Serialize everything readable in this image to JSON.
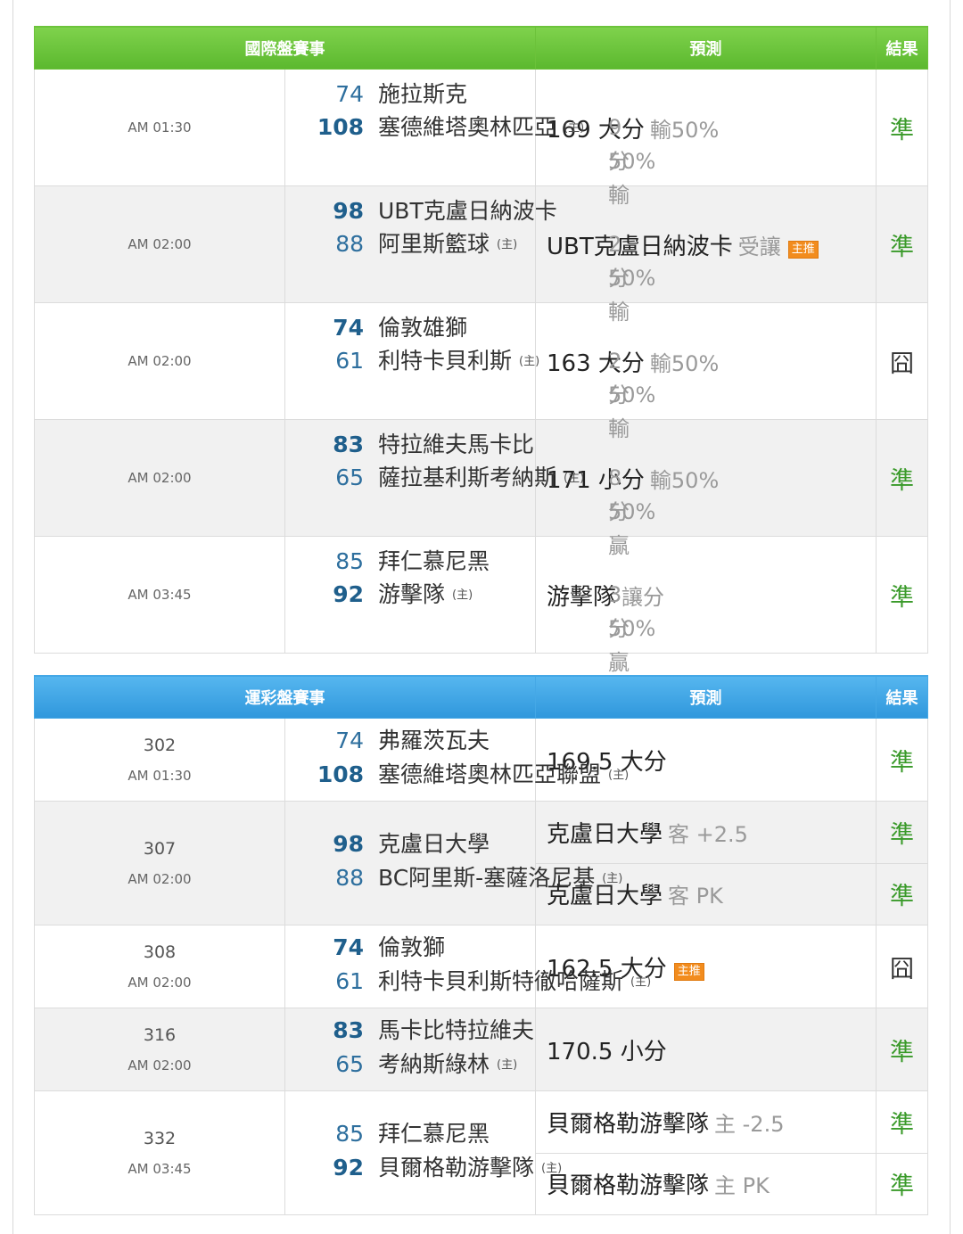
{
  "intl": {
    "header": {
      "event": "國際盤賽事",
      "pred": "預測",
      "result": "結果"
    },
    "rows": [
      {
        "time": "AM 01:30",
        "s1": "74",
        "t1": "施拉斯克",
        "s2": "108",
        "t2": "塞德維塔奧林匹亞",
        "home": "(主)",
        "sp1": "9分輸",
        "sp2": "50%",
        "pred": "169 大分",
        "predsub": "輸50%",
        "badge": "",
        "result": "準",
        "w1": false,
        "w2": true
      },
      {
        "time": "AM 02:00",
        "s1": "98",
        "t1": "UBT克盧日納波卡",
        "s2": "88",
        "t2": "阿里斯籃球",
        "home": "(主)",
        "sp1": "2分輸",
        "sp2": "50%",
        "pred": "UBT克盧日納波卡",
        "predsub": "受讓",
        "badge": "主推",
        "result": "準",
        "w1": true,
        "w2": false
      },
      {
        "time": "AM 02:00",
        "s1": "74",
        "t1": "倫敦雄獅",
        "s2": "61",
        "t2": "利特卡貝利斯",
        "home": "(主)",
        "sp1": "2分輸",
        "sp2": "50%",
        "pred": "163 大分",
        "predsub": "輸50%",
        "badge": "",
        "result": "囧",
        "w1": true,
        "w2": false
      },
      {
        "time": "AM 02:00",
        "s1": "83",
        "t1": "特拉維夫馬卡比",
        "s2": "65",
        "t2": "薩拉基利斯考納斯",
        "home": "(主)",
        "sp1": "8分贏",
        "sp2": "50%",
        "pred": "171 小分",
        "predsub": "輸50%",
        "badge": "",
        "result": "準",
        "w1": true,
        "w2": false
      },
      {
        "time": "AM 03:45",
        "s1": "85",
        "t1": "拜仁慕尼黑",
        "s2": "92",
        "t2": "游擊隊",
        "home": "(主)",
        "sp1": "3分贏",
        "sp2": "50%",
        "pred": "游擊隊",
        "predsub": "讓分",
        "badge": "",
        "result": "準",
        "w1": false,
        "w2": true
      }
    ]
  },
  "lott": {
    "header": {
      "event": "運彩盤賽事",
      "pred": "預測",
      "result": "結果"
    },
    "rows": [
      {
        "code": "302",
        "time": "AM 01:30",
        "s1": "74",
        "t1": "弗羅茨瓦夫",
        "s2": "108",
        "t2": "塞德維塔奧林匹亞聯盟",
        "home": "(主)",
        "w1": false,
        "w2": true,
        "preds": [
          {
            "main": "169.5 大分",
            "sub": "",
            "badge": "",
            "result": "準"
          }
        ]
      },
      {
        "code": "307",
        "time": "AM 02:00",
        "s1": "98",
        "t1": "克盧日大學",
        "s2": "88",
        "t2": "BC阿里斯-塞薩洛尼基",
        "home": "(主)",
        "w1": true,
        "w2": false,
        "preds": [
          {
            "main": "克盧日大學",
            "sub": "客 +2.5",
            "badge": "",
            "result": "準"
          },
          {
            "main": "克盧日大學",
            "sub": "客 PK",
            "badge": "",
            "result": "準"
          }
        ]
      },
      {
        "code": "308",
        "time": "AM 02:00",
        "s1": "74",
        "t1": "倫敦獅",
        "s2": "61",
        "t2": "利特卡貝利斯特徹哈薩斯",
        "home": "(主)",
        "w1": true,
        "w2": false,
        "preds": [
          {
            "main": "162.5 大分",
            "sub": "",
            "badge": "主推",
            "result": "囧"
          }
        ]
      },
      {
        "code": "316",
        "time": "AM 02:00",
        "s1": "83",
        "t1": "馬卡比特拉維夫",
        "s2": "65",
        "t2": "考納斯綠林",
        "home": "(主)",
        "w1": true,
        "w2": false,
        "preds": [
          {
            "main": "170.5 小分",
            "sub": "",
            "badge": "",
            "result": "準"
          }
        ]
      },
      {
        "code": "332",
        "time": "AM 03:45",
        "s1": "85",
        "t1": "拜仁慕尼黑",
        "s2": "92",
        "t2": "貝爾格勒游擊隊",
        "home": "(主)",
        "w1": false,
        "w2": true,
        "preds": [
          {
            "main": "貝爾格勒游擊隊",
            "sub": "主 -2.5",
            "badge": "",
            "result": "準"
          },
          {
            "main": "貝爾格勒游擊隊",
            "sub": "主 PK",
            "badge": "",
            "result": "準"
          }
        ]
      }
    ]
  }
}
